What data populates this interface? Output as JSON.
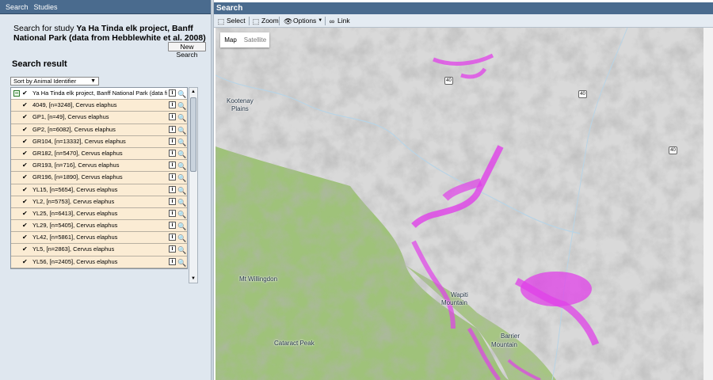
{
  "nav": {
    "tabs": [
      "Search",
      "Studies"
    ]
  },
  "search_panel": {
    "study_prefix": "Search for study ",
    "study_name": "Ya Ha Tinda elk project, Banff National Park (data from Hebblewhite et al. 2008)",
    "new_search_label": "New Search",
    "result_title": "Search result",
    "sort_selected": "Sort by Animal Identifier"
  },
  "results": {
    "header": "Ya Ha Tinda elk project, Banff National Park (data from",
    "items": [
      "4049, [n=3248], Cervus elaphus",
      "GP1, [n=49], Cervus elaphus",
      "GP2, [n=6082], Cervus elaphus",
      "GR104, [n=13332], Cervus elaphus",
      "GR182, [n=5470], Cervus elaphus",
      "GR193, [n=716], Cervus elaphus",
      "GR196, [n=1890], Cervus elaphus",
      "YL15, [n=5654], Cervus elaphus",
      "YL2, [n=5753], Cervus elaphus",
      "YL25, [n=6413], Cervus elaphus",
      "YL29, [n=5405], Cervus elaphus",
      "YL42, [n=5861], Cervus elaphus",
      "YL5, [n=2863], Cervus elaphus",
      "YL56, [n=2405], Cervus elaphus"
    ]
  },
  "map_panel": {
    "title": "Search",
    "toolbar": {
      "select": "Select",
      "zoom": "Zoom",
      "options": "Options",
      "link": "Link"
    },
    "map_type": {
      "map": "Map",
      "satellite": "Satellite"
    },
    "places": [
      "Kootenay",
      "Plains",
      "Mt Willingdon",
      "Wapiti",
      "Mountain",
      "Cataract Peak",
      "Barrier",
      "Mountain"
    ],
    "highway_shields": [
      "40",
      "40",
      "40"
    ]
  },
  "colors": {
    "header": "#4a6b8e",
    "terrain_green": "#9fc27a",
    "terrain_grey": "#cfcfcf",
    "tracks": "#e040e8"
  }
}
